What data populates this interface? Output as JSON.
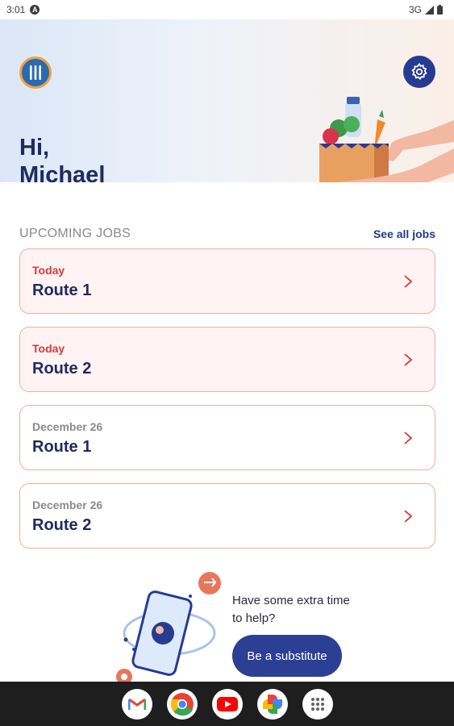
{
  "status_bar": {
    "time": "3:01",
    "network": "3G"
  },
  "header": {
    "greeting_line1": "Hi,",
    "greeting_line2": "Michael"
  },
  "upcoming": {
    "title": "UPCOMING JOBS",
    "see_all": "See all jobs",
    "jobs": [
      {
        "date": "Today",
        "title": "Route 1",
        "highlight": true
      },
      {
        "date": "Today",
        "title": "Route 2",
        "highlight": true
      },
      {
        "date": "December 26",
        "title": "Route 1",
        "highlight": false
      },
      {
        "date": "December 26",
        "title": "Route 2",
        "highlight": false
      }
    ]
  },
  "promo": {
    "text": "Have some extra time to help?",
    "button": "Be a substitute"
  },
  "dock": {
    "apps": [
      "gmail-icon",
      "chrome-icon",
      "youtube-icon",
      "photos-icon",
      "app-drawer-icon"
    ]
  },
  "colors": {
    "primary": "#263b91",
    "accent_red": "#d63a3a",
    "card_border": "#f2a9a9"
  }
}
